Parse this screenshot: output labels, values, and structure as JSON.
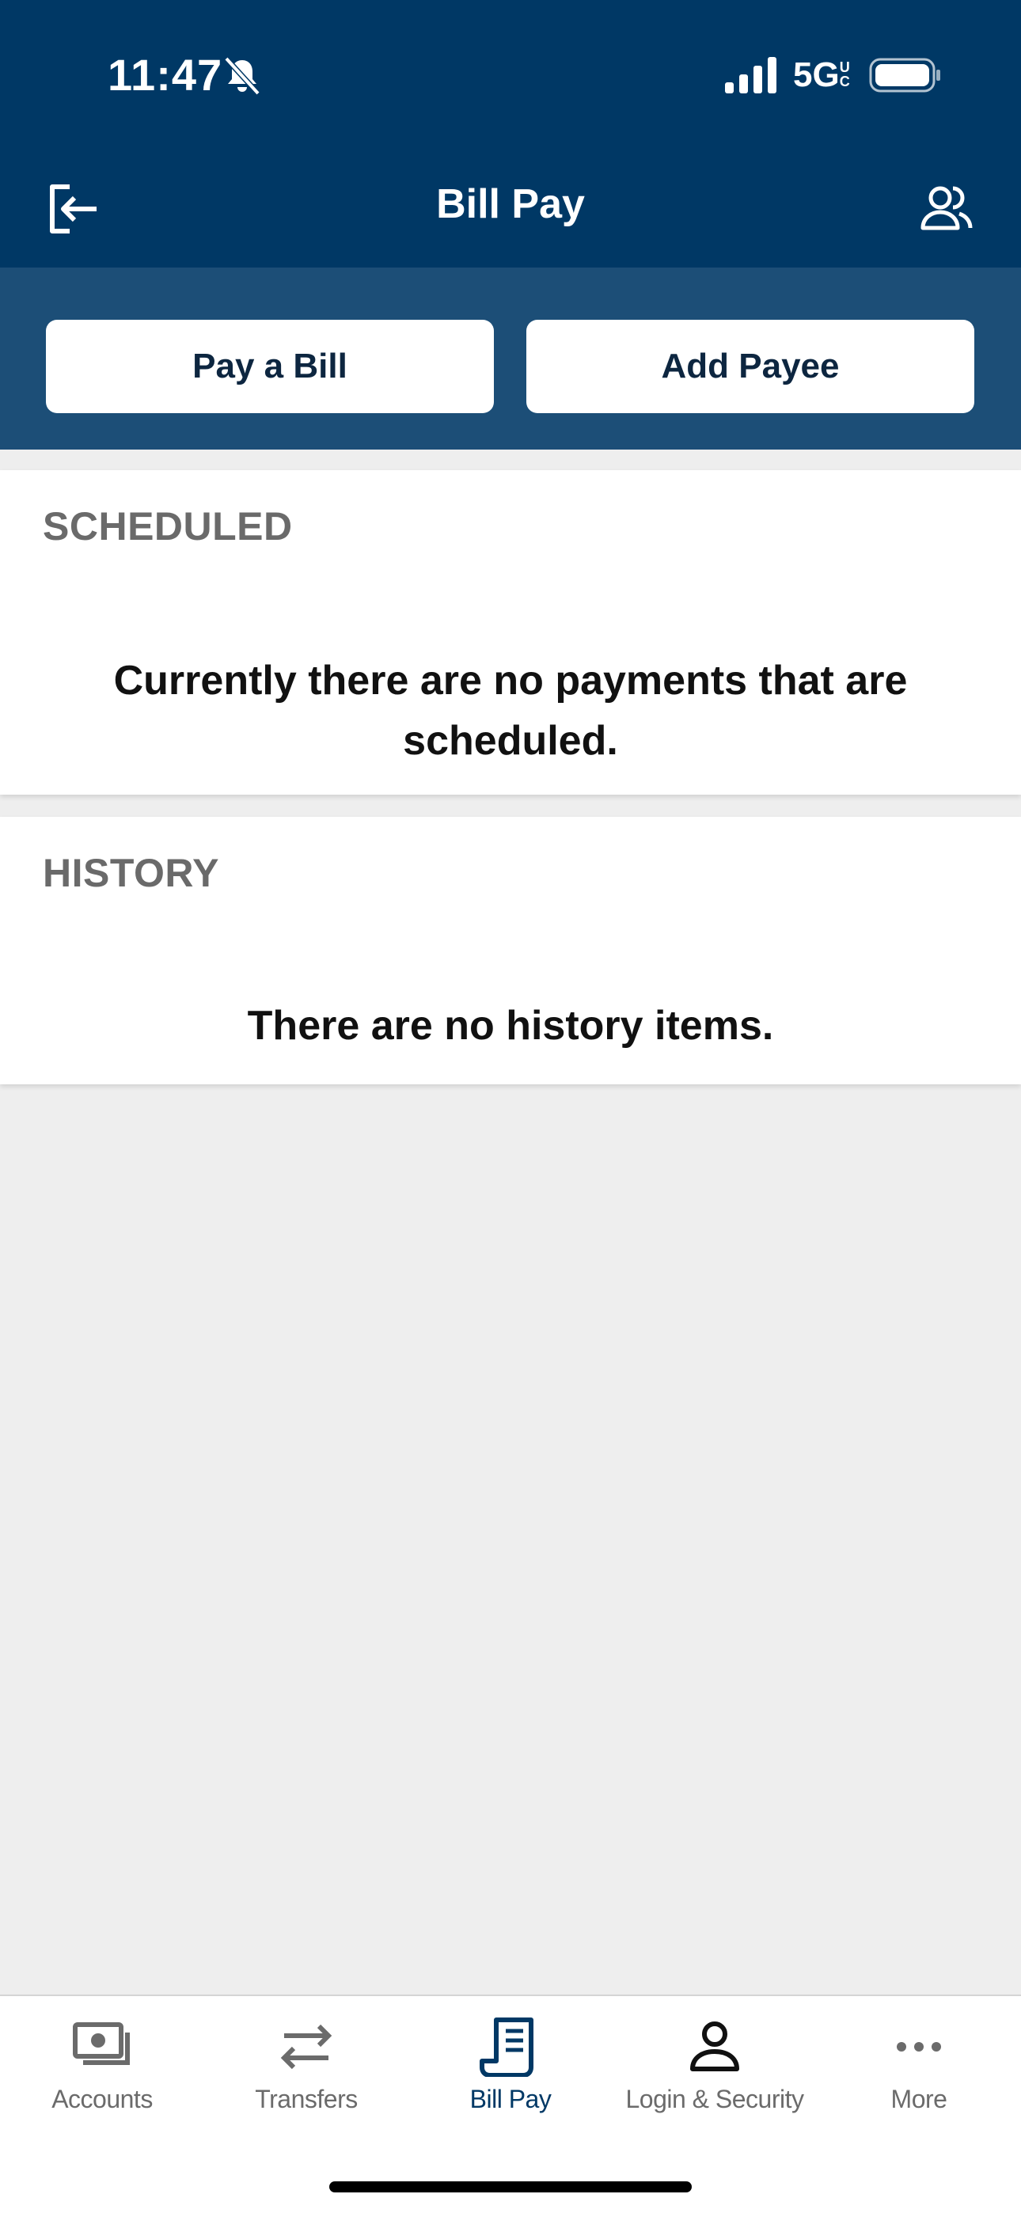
{
  "status_bar": {
    "time": "11:47",
    "network": "5G",
    "network_suffix": "UC",
    "icons": [
      "bell-slash-icon",
      "signal-icon",
      "battery-icon"
    ]
  },
  "header": {
    "title": "Bill Pay",
    "left_icon": "logout-icon",
    "right_icon": "profile-icon"
  },
  "actions": {
    "pay_label": "Pay a Bill",
    "add_label": "Add Payee"
  },
  "sections": {
    "scheduled": {
      "heading": "SCHEDULED",
      "empty_message": "Currently there are no payments that are scheduled."
    },
    "history": {
      "heading": "HISTORY",
      "empty_message": "There are no history items."
    }
  },
  "tabs": [
    {
      "label": "Accounts",
      "icon": "accounts-icon"
    },
    {
      "label": "Transfers",
      "icon": "transfers-icon"
    },
    {
      "label": "Bill Pay",
      "icon": "bill-pay-icon",
      "active": true
    },
    {
      "label": "Login & Security",
      "icon": "login-security-icon"
    },
    {
      "label": "More",
      "icon": "more-icon"
    }
  ],
  "colors": {
    "header_bg": "#003865",
    "action_row_bg": "#1c4e77",
    "active_tab": "#003865",
    "inactive_tab": "#6b6b6b",
    "page_bg": "#eeeeee"
  }
}
